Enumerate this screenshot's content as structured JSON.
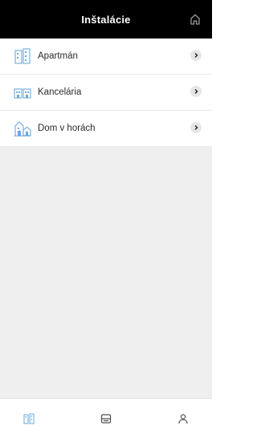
{
  "header": {
    "title": "Inštalácie",
    "home_icon": "home-icon"
  },
  "installations": [
    {
      "label": "Apartmán",
      "icon": "apartment-icon"
    },
    {
      "label": "Kancelária",
      "icon": "office-icon"
    },
    {
      "label": "Dom v horách",
      "icon": "house-icon"
    }
  ],
  "tabbar": {
    "tabs": [
      {
        "icon": "installations-icon",
        "active": true
      },
      {
        "icon": "device-icon",
        "active": false
      },
      {
        "icon": "user-icon",
        "active": false
      }
    ]
  },
  "colors": {
    "accent": "#6ea8dc",
    "header_bg": "#000000",
    "content_bg": "#efefef"
  }
}
